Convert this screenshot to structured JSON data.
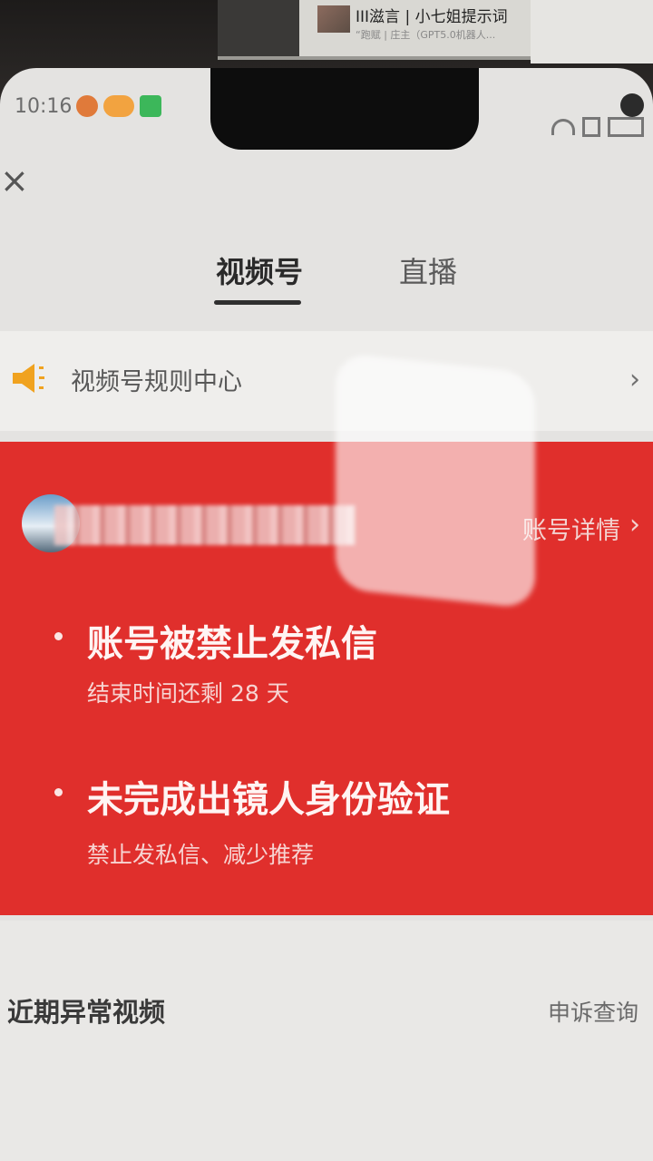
{
  "background": {
    "monitor_line1": "III滋言 | 小七姐提示词",
    "monitor_line2": "“跑赋 | 庄主（GPT5.0机器人..."
  },
  "status_bar": {
    "time": "10:16"
  },
  "tabs": [
    {
      "label": "视频号",
      "active": true
    },
    {
      "label": "直播",
      "active": false
    }
  ],
  "rules_center": {
    "label": "视频号规则中心",
    "chevron": "›"
  },
  "account_card": {
    "details_label": "账号详情",
    "chevron": "›",
    "color": "#e02f2c",
    "items": [
      {
        "title": "账号被禁止发私信",
        "subtitle": "结束时间还剩 28 天"
      },
      {
        "title": "未完成出镜人身份验证",
        "subtitle": "禁止发私信、减少推荐"
      }
    ]
  },
  "recent": {
    "title": "近期异常视频",
    "appeal_label": "申诉查询"
  },
  "close": "×"
}
